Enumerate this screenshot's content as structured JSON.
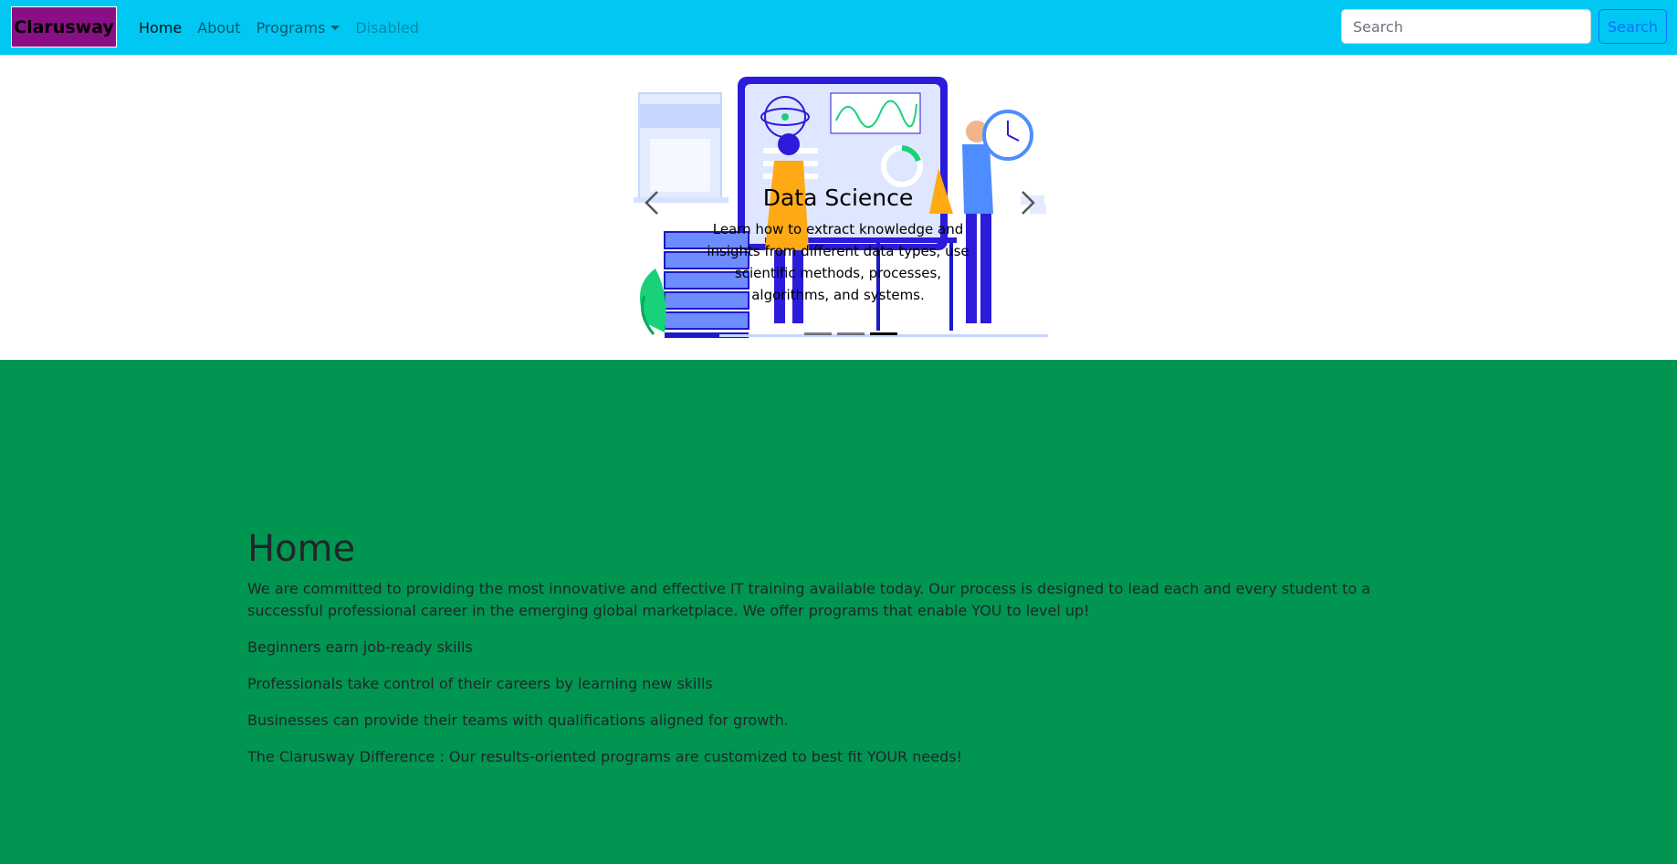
{
  "navbar": {
    "brand": "Clarusway",
    "links": [
      {
        "label": "Home",
        "state": "active"
      },
      {
        "label": "About",
        "state": "normal"
      },
      {
        "label": "Programs",
        "state": "dropdown"
      },
      {
        "label": "Disabled",
        "state": "disabled"
      }
    ],
    "search_placeholder": "Search",
    "search_button": "Search",
    "colors": {
      "bar": "#00c8f2",
      "brand_bg": "#8a0f86"
    }
  },
  "carousel": {
    "title": "Data Science",
    "text": "Learn how to extract knowledge and insights from different data types, use scientific methods, processes, algorithms, and systems.",
    "prev_icon": "chevron-left-icon",
    "next_icon": "chevron-right-icon",
    "slide_count": 3,
    "active_slide": 3
  },
  "home": {
    "title": "Home",
    "paragraphs": [
      "We are committed to providing the most innovative and effective IT training available today. Our process is designed to lead each and every student to a successful professional career in the emerging global marketplace. We offer programs that enable YOU to level up!",
      "Beginners earn job-ready skills",
      "Professionals take control of their careers by learning new skills",
      "Businesses can provide their teams with qualifications aligned for growth.",
      "The Clarusway Difference : Our results-oriented programs are customized to best fit YOUR needs!"
    ],
    "background": "#009651"
  }
}
